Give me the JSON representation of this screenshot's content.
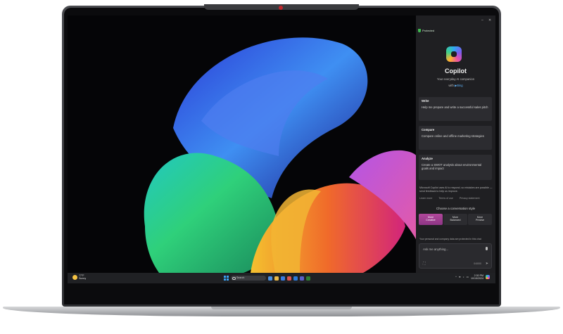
{
  "panel": {
    "status": "Protected",
    "title": "Copilot",
    "subtitle": "Your everyday AI companion",
    "with_prefix": "with",
    "with_brand": "Bing",
    "cards": [
      {
        "heading": "Write",
        "text": "Help me prepare and write a successful sales pitch"
      },
      {
        "heading": "Compare",
        "text": "Compare online and offline marketing strategies"
      },
      {
        "heading": "Analyze",
        "text": "Create a SWOT analysis about environmental goals and impact"
      }
    ],
    "disclaimer": "Microsoft Copilot uses AI to respond, so mistakes are possible — send feedback to help us improve.",
    "links": [
      "Learn more",
      "Terms of use",
      "Privacy statement"
    ],
    "style_heading": "Choose a conversation style",
    "styles": [
      {
        "line1": "More",
        "line2": "Creative",
        "active": true
      },
      {
        "line1": "More",
        "line2": "Balanced",
        "active": false
      },
      {
        "line1": "More",
        "line2": "Precise",
        "active": false
      }
    ],
    "privacy": "Your personal and company data are protected in this chat",
    "input_placeholder": "Ask me anything...",
    "char_count": "0/4000",
    "window_minimize": "–",
    "window_close": "✕"
  },
  "taskbar": {
    "weather_temp": "77°F",
    "weather_desc": "Sunny",
    "search_label": "Search",
    "time": "2:30 PM",
    "date": "10/15/2024"
  },
  "colors": {
    "accent_creative": "#a13f93",
    "panel_bg": "#1f1f22",
    "taskbar_bg": "#202124",
    "shield": "#3fb950"
  },
  "icons": [
    "shield-icon",
    "copilot-logo-icon",
    "bing-icon",
    "mic-icon",
    "send-icon",
    "scan-icon",
    "windows-start-icon",
    "search-icon",
    "wifi-icon",
    "volume-icon",
    "battery-icon"
  ]
}
